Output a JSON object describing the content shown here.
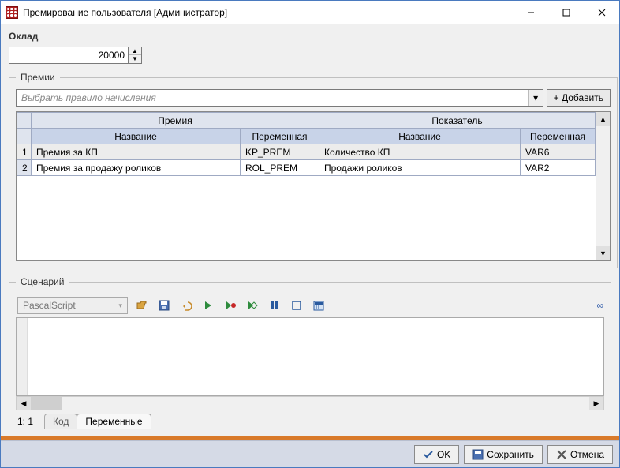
{
  "window": {
    "title": "Премирование пользователя [Администратор]"
  },
  "salary": {
    "label": "Оклад",
    "value": "20000"
  },
  "bonuses": {
    "legend": "Премии",
    "rulePlaceholder": "Выбрать правило начисления",
    "addButton": "+ Добавить",
    "headers": {
      "premium": "Премия",
      "indicator": "Показатель",
      "name": "Название",
      "variable": "Переменная"
    },
    "rows": [
      {
        "n": "1",
        "premName": "Премия за КП",
        "premVar": "KP_PREM",
        "indName": "Количество КП",
        "indVar": "VAR6"
      },
      {
        "n": "2",
        "premName": "Премия за продажу роликов",
        "premVar": "ROL_PREM",
        "indName": "Продажи роликов",
        "indVar": "VAR2"
      }
    ]
  },
  "script": {
    "legend": "Сценарий",
    "language": "PascalScript",
    "position": "1: 1",
    "tabs": {
      "code": "Код",
      "vars": "Переменные"
    }
  },
  "buttons": {
    "ok": "OK",
    "save": "Сохранить",
    "cancel": "Отмена"
  }
}
